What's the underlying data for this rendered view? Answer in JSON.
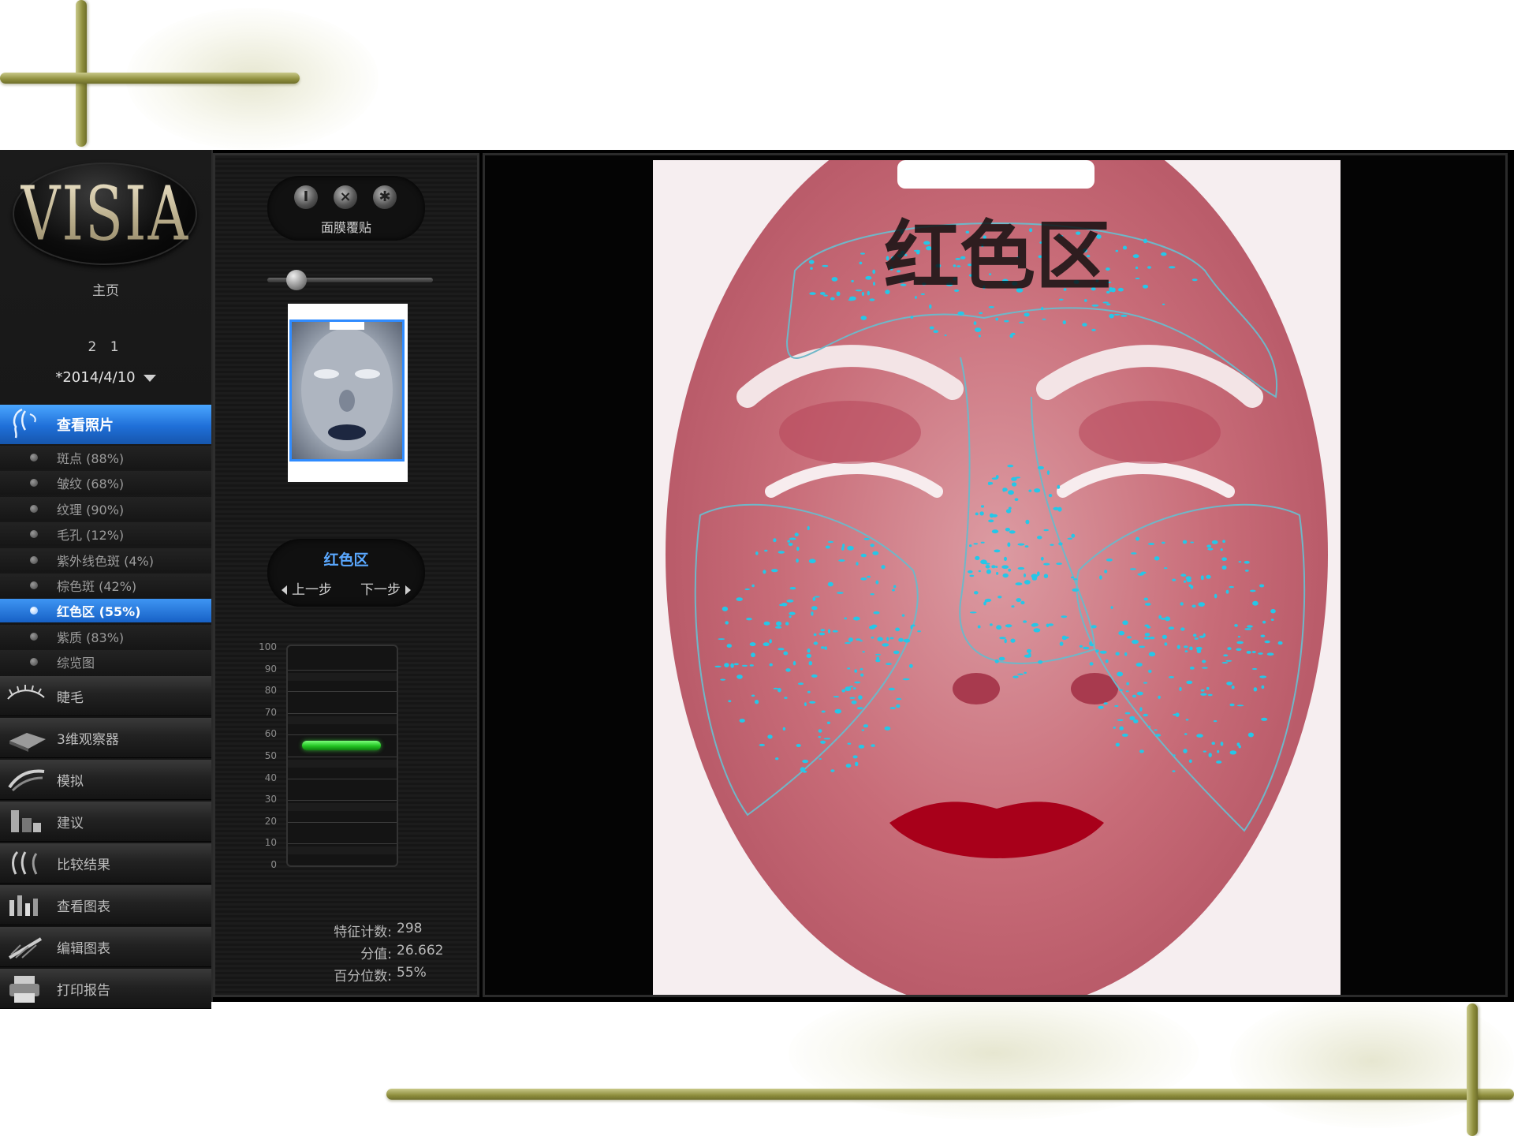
{
  "sidebar": {
    "logo": "VISIA",
    "home_label": "主页",
    "client_id": "2 1",
    "date": "*2014/4/10",
    "view_photos_label": "查看照片",
    "analysis_items": [
      {
        "label": "斑点 (88%)",
        "active": false
      },
      {
        "label": "皱纹 (68%)",
        "active": false
      },
      {
        "label": "纹理 (90%)",
        "active": false
      },
      {
        "label": "毛孔 (12%)",
        "active": false
      },
      {
        "label": "紫外线色斑 (4%)",
        "active": false
      },
      {
        "label": "棕色斑 (42%)",
        "active": false
      },
      {
        "label": "红色区 (55%)",
        "active": true
      },
      {
        "label": "紫质 (83%)",
        "active": false
      },
      {
        "label": "综览图",
        "active": false
      }
    ],
    "main_items": [
      {
        "label": "睫毛",
        "icon": "eyelash-icon"
      },
      {
        "label": "3维观察器",
        "icon": "3d-viewer-icon"
      },
      {
        "label": "模拟",
        "icon": "simulation-icon"
      },
      {
        "label": "建议",
        "icon": "recommendation-icon"
      },
      {
        "label": "比较结果",
        "icon": "compare-icon"
      },
      {
        "label": "查看图表",
        "icon": "chart-icon"
      },
      {
        "label": "编辑图表",
        "icon": "edit-chart-icon"
      },
      {
        "label": "打印报告",
        "icon": "printer-icon"
      }
    ]
  },
  "panel": {
    "mask_label": "面膜覆贴",
    "region_title": "红色区",
    "prev_label": "上一步",
    "next_label": "下一步",
    "gauge": {
      "ticks": [
        "100",
        "90",
        "80",
        "70",
        "60",
        "50",
        "40",
        "30",
        "20",
        "10",
        "0"
      ],
      "value_percent": 55,
      "color": "#22c422"
    },
    "stats": {
      "feature_count_label": "特征计数:",
      "feature_count": "298",
      "score_label": "分值:",
      "score": "26.662",
      "percentile_label": "百分位数:",
      "percentile": "55%"
    }
  },
  "view": {
    "title": "红色区",
    "highlight_color": "#25c7e8"
  },
  "colors": {
    "accent_blue": "#1f6fd8",
    "region_title_blue": "#5aa8ff"
  }
}
